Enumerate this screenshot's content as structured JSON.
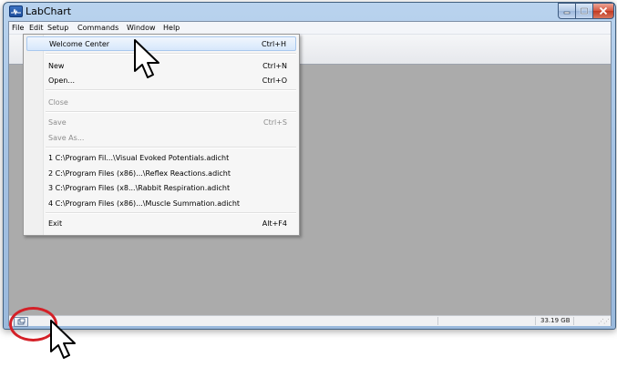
{
  "window": {
    "title": "LabChart"
  },
  "menubar": {
    "items": [
      "File",
      "Edit",
      "Setup",
      "Commands",
      "Window",
      "Help"
    ]
  },
  "file_menu": {
    "welcome_center": {
      "label": "Welcome Center",
      "shortcut": "Ctrl+H"
    },
    "new": {
      "label": "New",
      "shortcut": "Ctrl+N"
    },
    "open": {
      "label": "Open...",
      "shortcut": "Ctrl+O"
    },
    "close": {
      "label": "Close"
    },
    "save": {
      "label": "Save",
      "shortcut": "Ctrl+S"
    },
    "save_as": {
      "label": "Save As..."
    },
    "recent_files": [
      "1 C:\\Program Fil...\\Visual Evoked Potentials.adicht",
      "2 C:\\Program Files (x86)...\\Reflex Reactions.adicht",
      "3 C:\\Program Files (x8...\\Rabbit Respiration.adicht",
      "4 C:\\Program Files (x86)...\\Muscle Summation.adicht"
    ],
    "exit": {
      "label": "Exit",
      "shortcut": "Alt+F4"
    }
  },
  "statusbar": {
    "disk_space": "33.19 GB"
  },
  "icons": {
    "app": "labchart-app-icon",
    "minimize": "minimize-icon",
    "maximize": "maximize-icon",
    "close": "close-icon",
    "statusbar_button": "window-toggle-icon",
    "cursor": "mouse-pointer-icon"
  },
  "colors": {
    "highlight_circle": "#d42027",
    "menu_hover": "#d6e7fb",
    "workspace": "#ababab",
    "close_button": "#c13a22"
  }
}
